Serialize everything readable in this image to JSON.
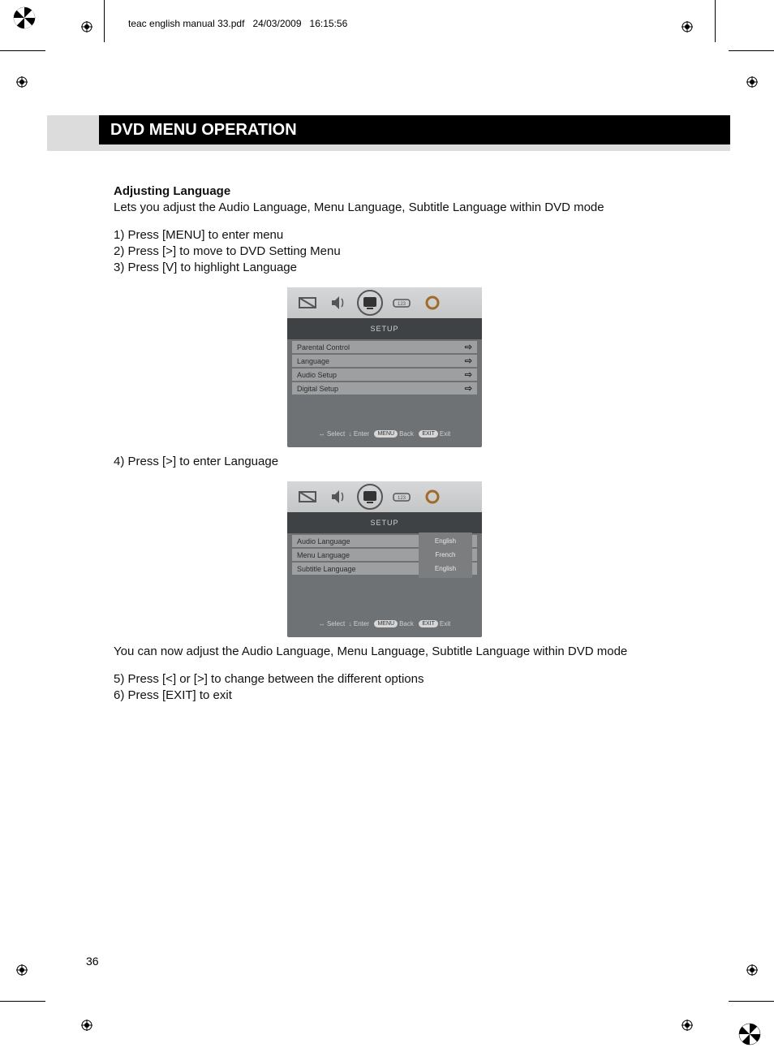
{
  "header": {
    "filename": "teac english manual 33.pdf",
    "date": "24/03/2009",
    "time": "16:15:56"
  },
  "title": "DVD MENU OPERATION",
  "section_heading": "Adjusting Language",
  "intro": "Lets you adjust the Audio Language, Menu Language, Subtitle Language within DVD mode",
  "steps_a": [
    "1) Press [MENU] to enter menu",
    "2) Press [>] to move to DVD Setting Menu",
    "3) Press [V] to highlight Language"
  ],
  "osd1": {
    "setup_label": "SETUP",
    "rows": [
      {
        "label": "Parental Control"
      },
      {
        "label": "Language"
      },
      {
        "label": "Audio Setup"
      },
      {
        "label": "Digital Setup"
      }
    ],
    "hints": {
      "select": "Select",
      "enter": "Enter",
      "menu": "MENU",
      "back": "Back",
      "exit_btn": "EXIT",
      "exit": "Exit",
      "arrows_lr": "↔",
      "arrow_d": "↓"
    }
  },
  "step4": "4) Press [>] to enter Language",
  "osd2": {
    "setup_label": "SETUP",
    "rows": [
      {
        "label": "Audio Language",
        "value": "English"
      },
      {
        "label": "Menu Language",
        "value": "French"
      },
      {
        "label": "Subtitle Language",
        "value": "English"
      }
    ],
    "hints": {
      "select": "Select",
      "enter": "Enter",
      "menu": "MENU",
      "back": "Back",
      "exit_btn": "EXIT",
      "exit": "Exit",
      "arrows_lr": "↔",
      "arrow_d": "↓"
    }
  },
  "after": "You can now adjust the Audio Language, Menu Language, Subtitle Language within DVD mode",
  "steps_b": [
    "5) Press [<] or [>] to change between the different options",
    "6) Press [EXIT] to exit"
  ],
  "page_number": "36"
}
